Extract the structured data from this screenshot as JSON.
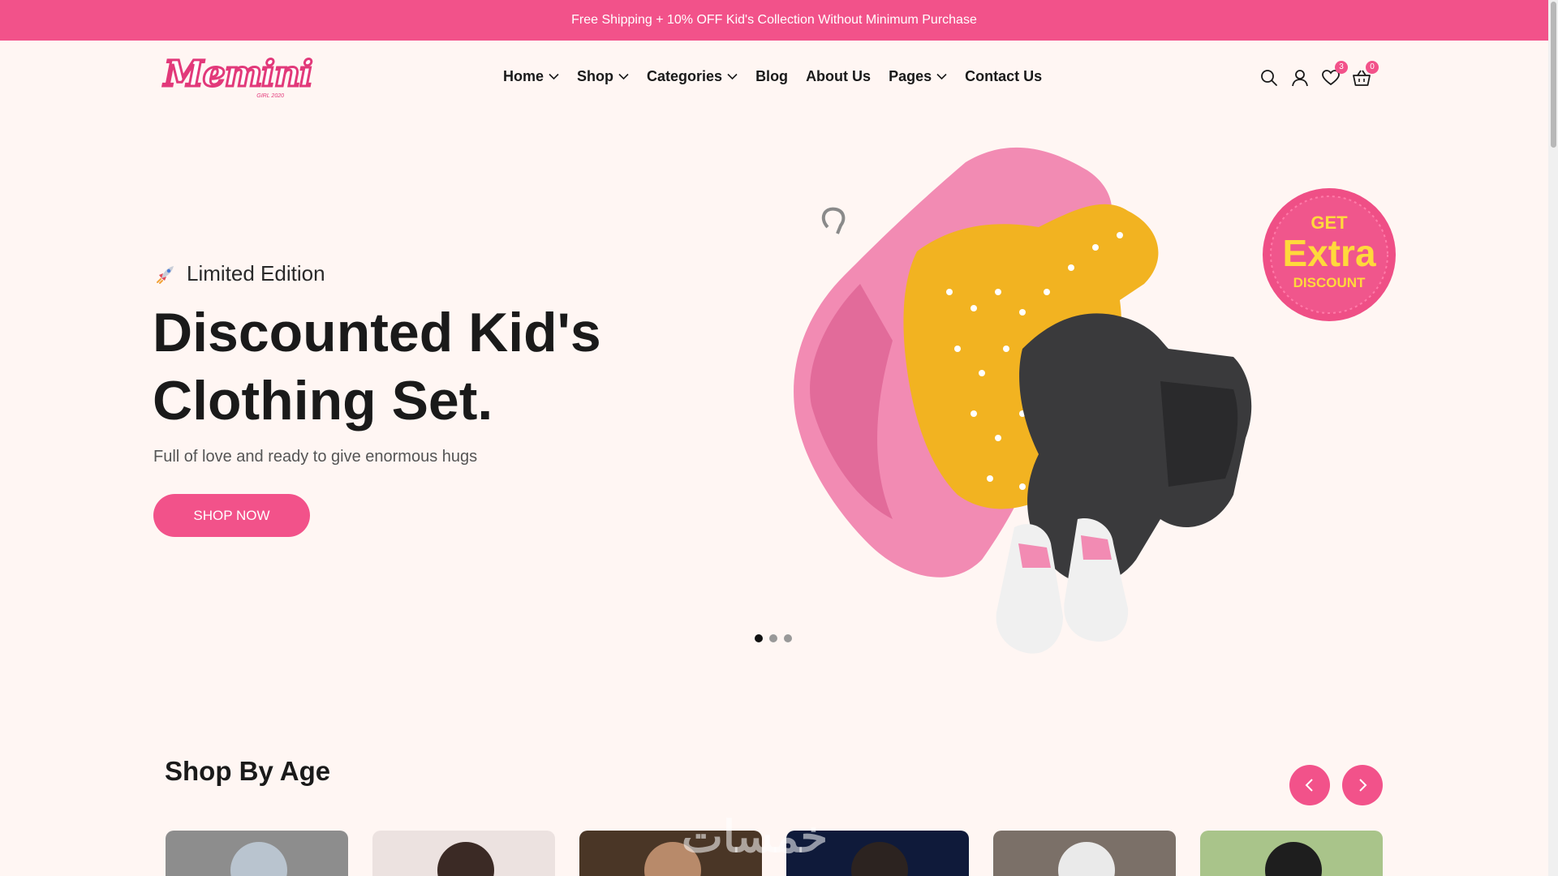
{
  "announcement": "Free Shipping + 10% OFF Kid's Collection Without Minimum Purchase",
  "brand": {
    "name": "Memini",
    "tagline": "GIRL 2020"
  },
  "nav": [
    {
      "label": "Home",
      "dropdown": true
    },
    {
      "label": "Shop",
      "dropdown": true
    },
    {
      "label": "Categories",
      "dropdown": true
    },
    {
      "label": "Blog",
      "dropdown": false
    },
    {
      "label": "About Us",
      "dropdown": false
    },
    {
      "label": "Pages",
      "dropdown": true
    },
    {
      "label": "Contact Us",
      "dropdown": false
    }
  ],
  "header_icons": {
    "search": "search-icon",
    "account": "user-icon",
    "wishlist": {
      "icon": "heart-icon",
      "count": "3"
    },
    "cart": {
      "icon": "basket-icon",
      "count": "0"
    }
  },
  "hero": {
    "tag": "Limited Edition",
    "title_line1": "Discounted Kid's",
    "title_line2": "Clothing Set.",
    "subtitle": "Full of love and ready to give enormous hugs",
    "cta": "SHOP NOW",
    "badge": {
      "line1": "GET",
      "line2": "Extra",
      "line3": "DISCOUNT"
    },
    "slides": 3,
    "active_slide": 1
  },
  "shop_by_age": {
    "title": "Shop By Age",
    "prev_icon": "chevron-left-icon",
    "next_icon": "chevron-right-icon",
    "cards": 6
  },
  "watermark": "خمسات",
  "colors": {
    "accent": "#f2528a",
    "background": "#fff6f3",
    "text": "#1a1a1a"
  }
}
